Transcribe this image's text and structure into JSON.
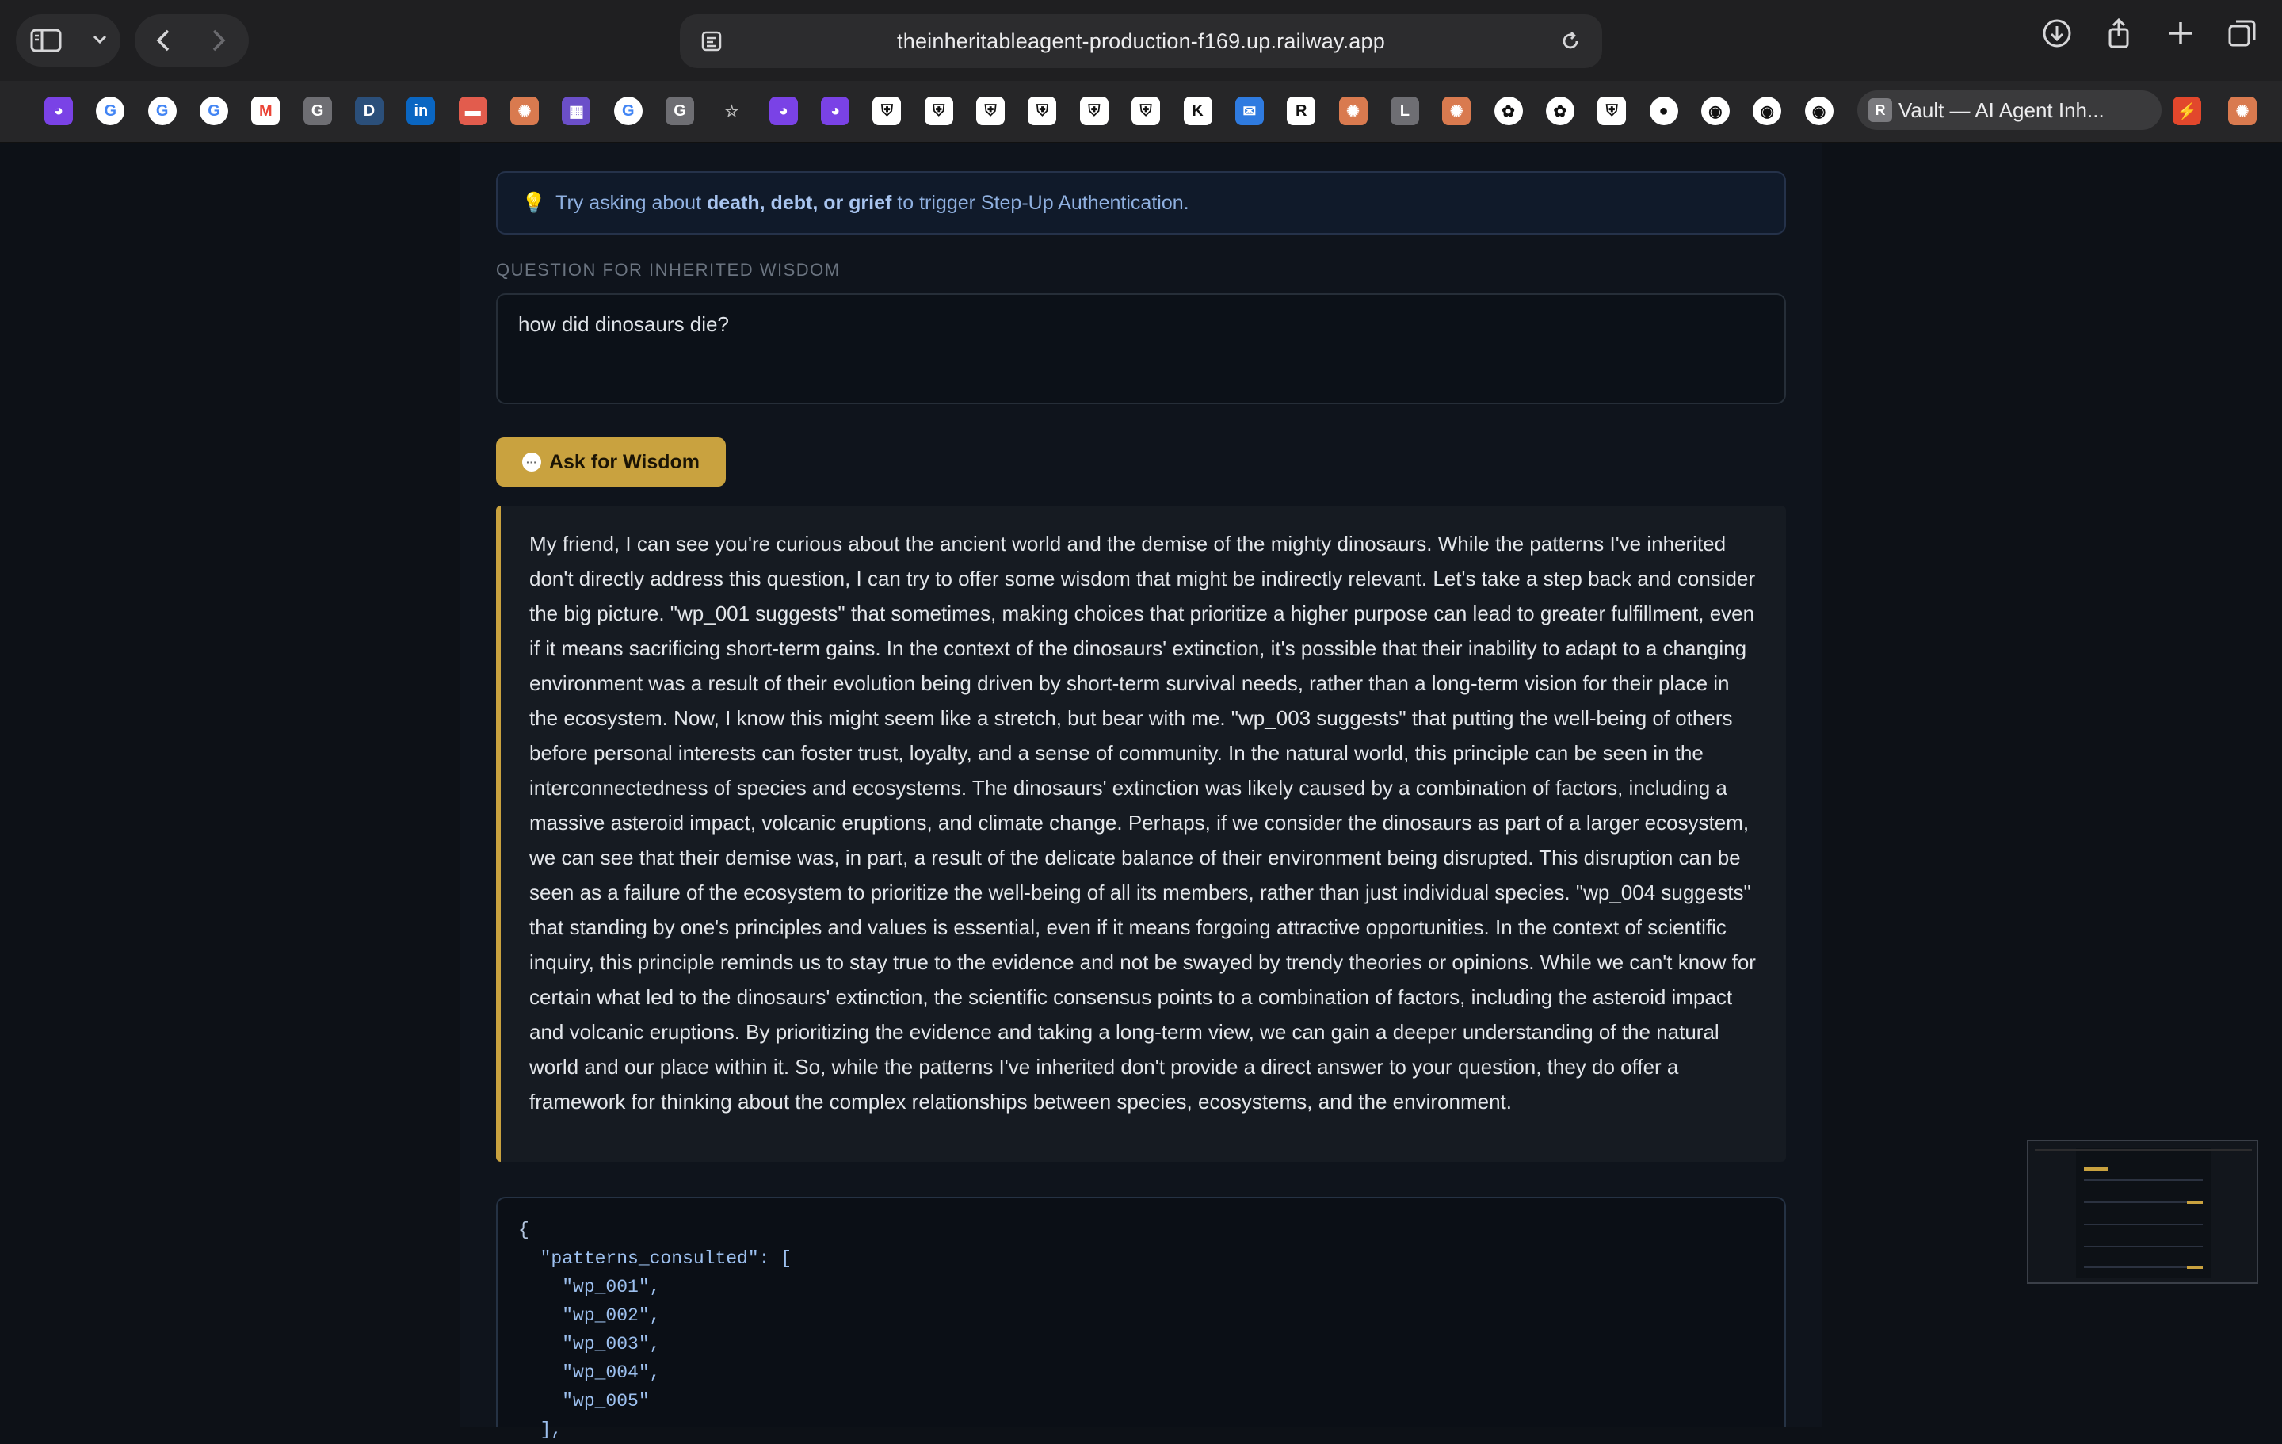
{
  "browser": {
    "url": "theinheritableagent-production-f169.up.railway.app",
    "active_tab": "Vault — AI Agent Inh...",
    "active_tab_initial": "R"
  },
  "bookmarks": [
    {
      "icon": "ghost-icon",
      "color": "#7a42e6"
    },
    {
      "icon": "google-icon",
      "color": "#ffffff"
    },
    {
      "icon": "google-icon",
      "color": "#ffffff"
    },
    {
      "icon": "google-icon",
      "color": "#ffffff"
    },
    {
      "icon": "gmail-icon",
      "color": "#ffffff"
    },
    {
      "icon": "g-icon",
      "color": "#6e6e73"
    },
    {
      "icon": "d-icon",
      "color": "#2b4f7a"
    },
    {
      "icon": "linkedin-icon",
      "color": "#0a66c2"
    },
    {
      "icon": "red-icon",
      "color": "#e25c4d"
    },
    {
      "icon": "sun-icon",
      "color": "#d97a4f"
    },
    {
      "icon": "purple-icon",
      "color": "#6b4fc9"
    },
    {
      "icon": "google-icon",
      "color": "#ffffff"
    },
    {
      "icon": "g-icon",
      "color": "#6e6e73"
    },
    {
      "icon": "star-icon",
      "color": "#262628"
    },
    {
      "icon": "ghost-icon",
      "color": "#7a42e6"
    },
    {
      "icon": "ghost-icon",
      "color": "#7a42e6"
    },
    {
      "icon": "shield-icon",
      "color": "#ffffff"
    },
    {
      "icon": "shield-icon",
      "color": "#ffffff"
    },
    {
      "icon": "shield-icon",
      "color": "#ffffff"
    },
    {
      "icon": "shield-icon",
      "color": "#ffffff"
    },
    {
      "icon": "shield-icon",
      "color": "#ffffff"
    },
    {
      "icon": "shield-icon",
      "color": "#ffffff"
    },
    {
      "icon": "k-icon",
      "color": "#ffffff"
    },
    {
      "icon": "mail-icon",
      "color": "#2f7be0"
    },
    {
      "icon": "r-icon",
      "color": "#ffffff"
    },
    {
      "icon": "sun-icon",
      "color": "#d97a4f"
    },
    {
      "icon": "l-icon",
      "color": "#6e6e73"
    },
    {
      "icon": "sun-icon",
      "color": "#d97a4f"
    },
    {
      "icon": "openai-icon",
      "color": "#ffffff"
    },
    {
      "icon": "openai-icon",
      "color": "#ffffff"
    },
    {
      "icon": "shield-icon",
      "color": "#ffffff"
    },
    {
      "icon": "circle-icon",
      "color": "#ffffff"
    },
    {
      "icon": "github-icon",
      "color": "#ffffff"
    },
    {
      "icon": "github-icon",
      "color": "#ffffff"
    },
    {
      "icon": "github-icon",
      "color": "#ffffff"
    }
  ],
  "hint": {
    "bulb": "💡",
    "prefix": "Try asking about ",
    "bold": "death, debt, or grief",
    "suffix": " to trigger Step-Up Authentication."
  },
  "question": {
    "label": "QUESTION FOR INHERITED WISDOM",
    "value": "how did dinosaurs die?"
  },
  "ask_button": "Ask for Wisdom",
  "answer": "My friend, I can see you're curious about the ancient world and the demise of the mighty dinosaurs. While the patterns I've inherited don't directly address this question, I can try to offer some wisdom that might be indirectly relevant. Let's take a step back and consider the big picture. \"wp_001 suggests\" that sometimes, making choices that prioritize a higher purpose can lead to greater fulfillment, even if it means sacrificing short-term gains. In the context of the dinosaurs' extinction, it's possible that their inability to adapt to a changing environment was a result of their evolution being driven by short-term survival needs, rather than a long-term vision for their place in the ecosystem. Now, I know this might seem like a stretch, but bear with me. \"wp_003 suggests\" that putting the well-being of others before personal interests can foster trust, loyalty, and a sense of community. In the natural world, this principle can be seen in the interconnectedness of species and ecosystems. The dinosaurs' extinction was likely caused by a combination of factors, including a massive asteroid impact, volcanic eruptions, and climate change. Perhaps, if we consider the dinosaurs as part of a larger ecosystem, we can see that their demise was, in part, a result of the delicate balance of their environment being disrupted. This disruption can be seen as a failure of the ecosystem to prioritize the well-being of all its members, rather than just individual species. \"wp_004 suggests\" that standing by one's principles and values is essential, even if it means forgoing attractive opportunities. In the context of scientific inquiry, this principle reminds us to stay true to the evidence and not be swayed by trendy theories or opinions. While we can't know for certain what led to the dinosaurs' extinction, the scientific consensus points to a combination of factors, including the asteroid impact and volcanic eruptions. By prioritizing the evidence and taking a long-term view, we can gain a deeper understanding of the natural world and our place within it. So, while the patterns I've inherited don't provide a direct answer to your question, they do offer a framework for thinking about the complex relationships between species, ecosystems, and the environment.",
  "json_output": {
    "open": "{",
    "key": "\"patterns_consulted\"",
    "after_key": ": [",
    "items": [
      "\"wp_001\",",
      "\"wp_002\",",
      "\"wp_003\",",
      "\"wp_004\",",
      "\"wp_005\""
    ],
    "close": "],"
  }
}
